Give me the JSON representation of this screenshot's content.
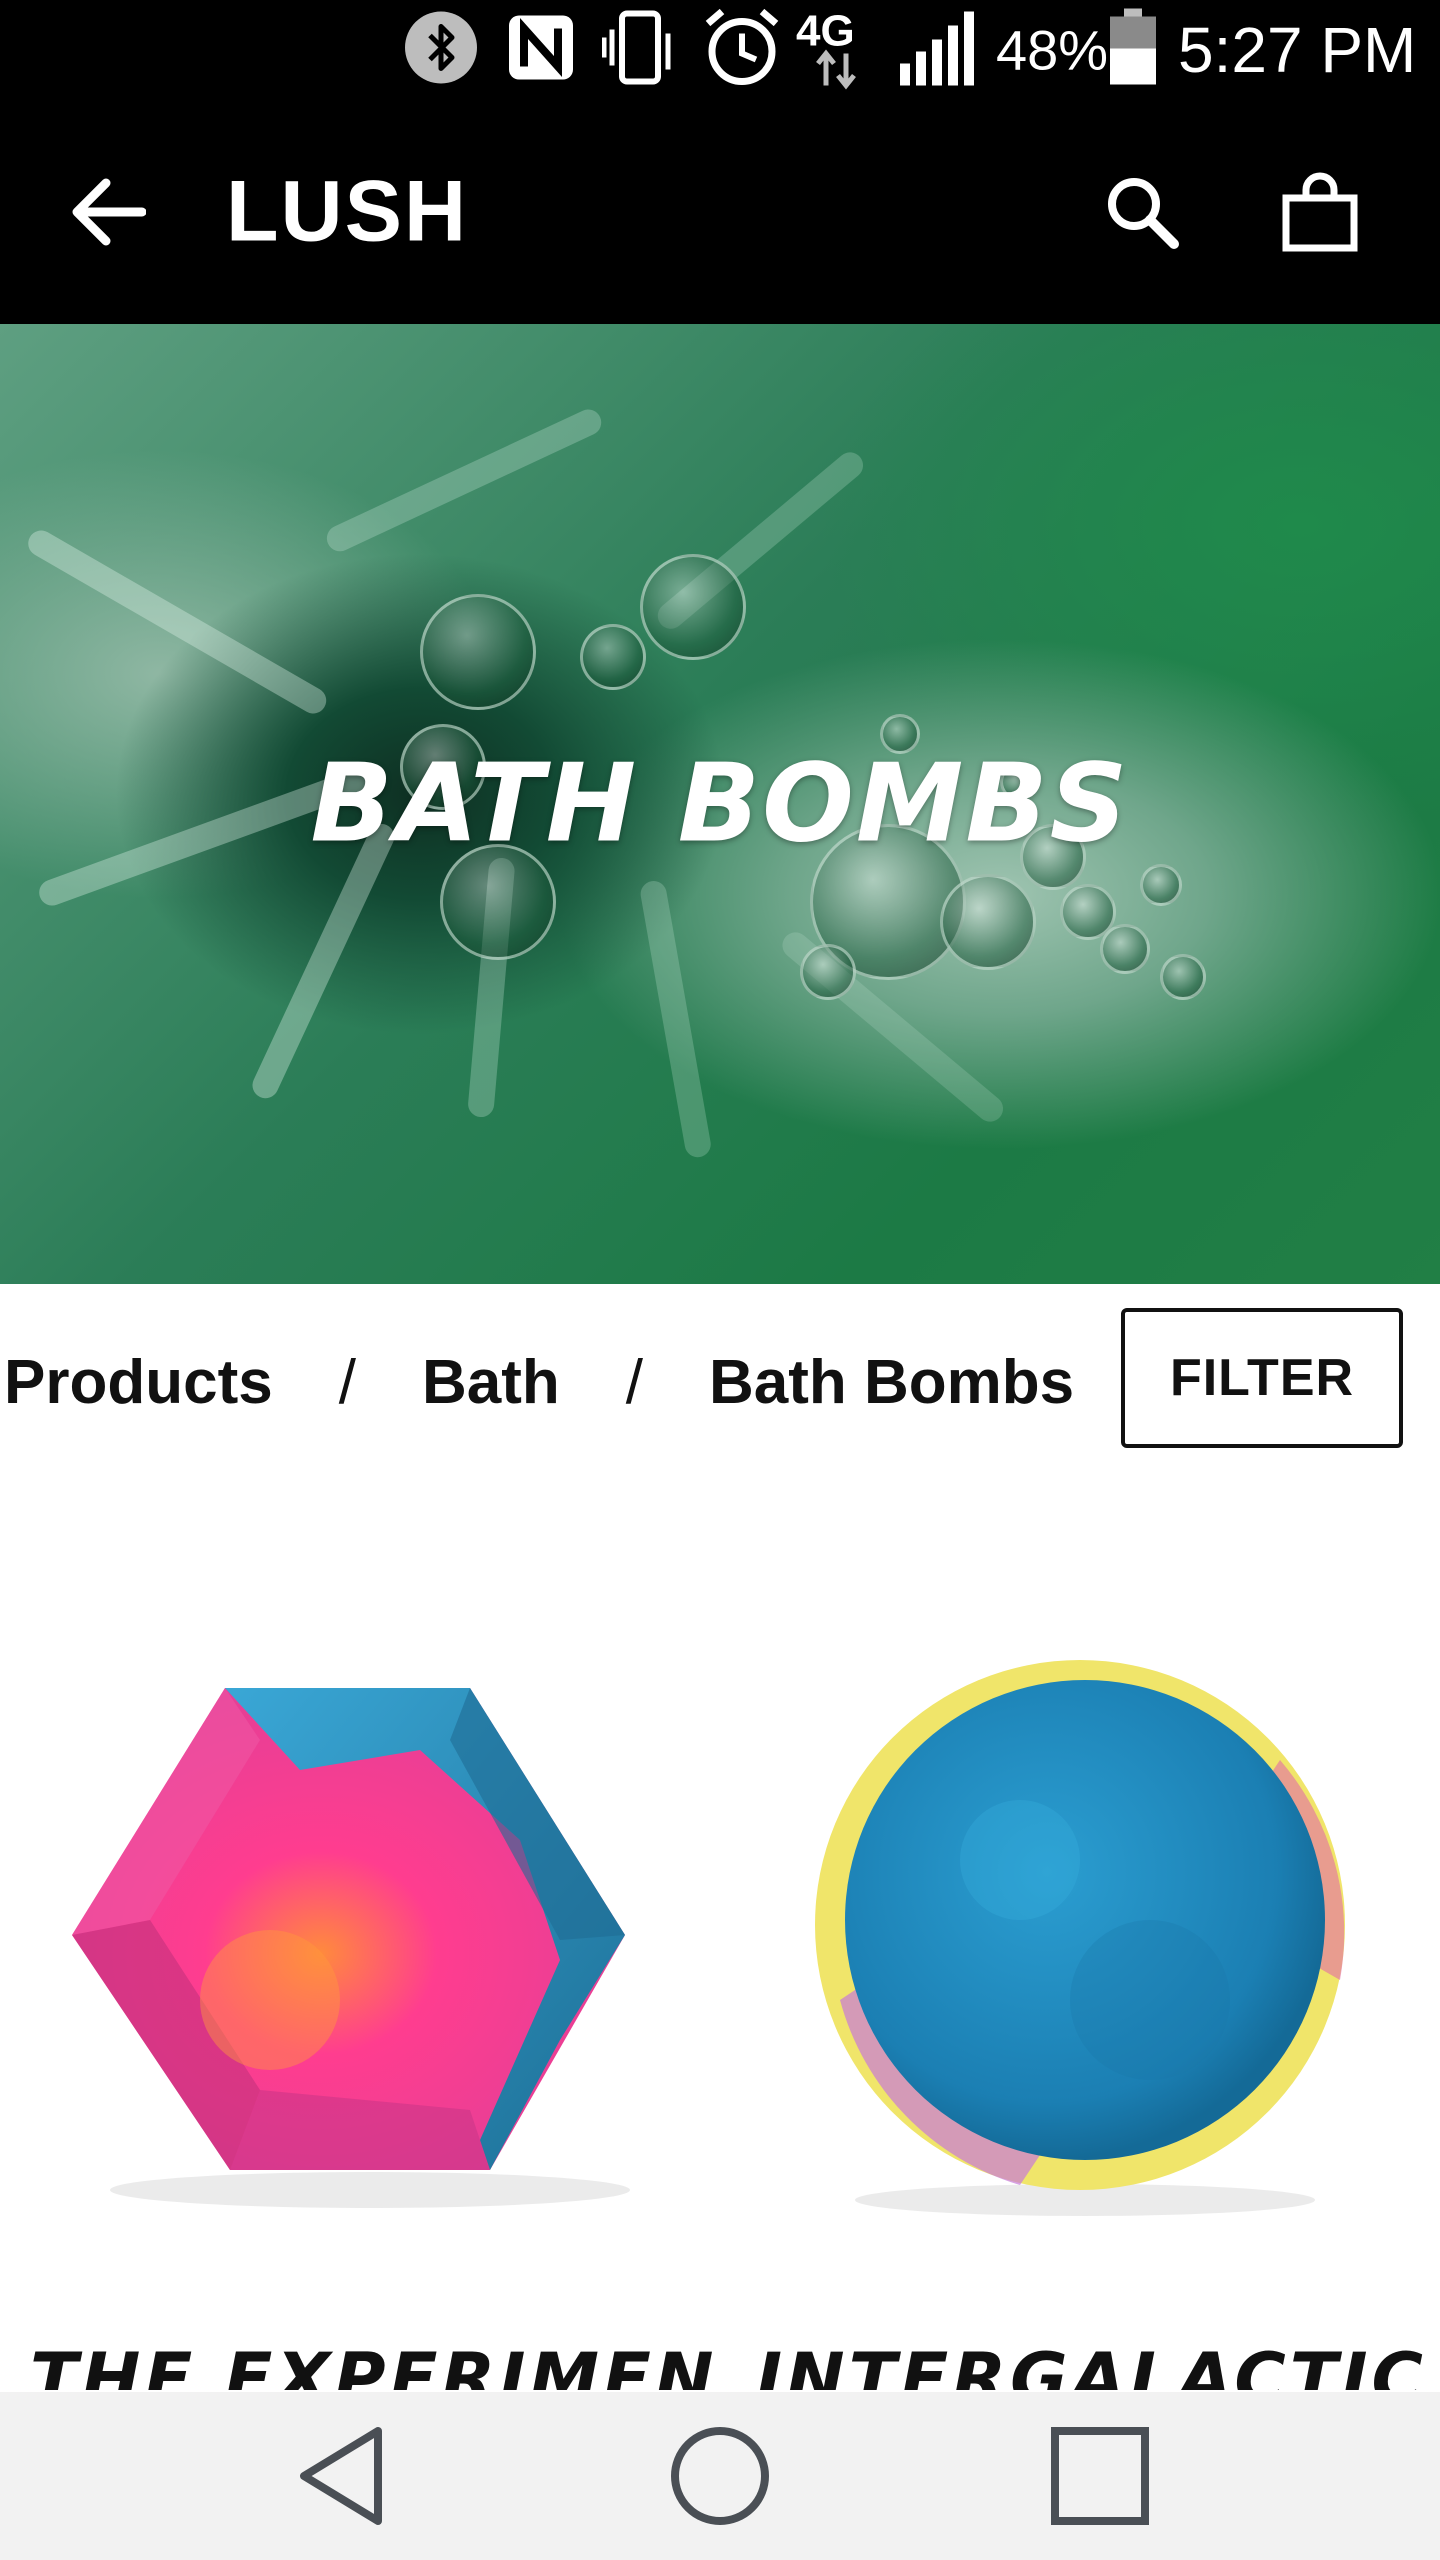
{
  "status_bar": {
    "battery": "48%",
    "time": "5:27 PM",
    "network": "4G",
    "icons": [
      "bluetooth-icon",
      "nfc-icon",
      "vibrate-icon",
      "alarm-icon",
      "4g-lte-icon",
      "signal-icon",
      "battery-icon"
    ]
  },
  "app_bar": {
    "title": "LUSH",
    "icons": [
      "back-arrow-icon",
      "search-icon",
      "shopping-bag-icon"
    ]
  },
  "hero": {
    "title": "BATH BOMBS"
  },
  "breadcrumb": {
    "items": [
      "Products",
      "Bath",
      "Bath Bombs"
    ],
    "separator": "/"
  },
  "filter": {
    "label": "FILTER"
  },
  "products": [
    {
      "name": "THE EXPERIMENTER"
    },
    {
      "name": "INTERGALACTIC"
    }
  ],
  "nav_bar": {
    "icons": [
      "back-triangle-icon",
      "home-circle-icon",
      "recents-square-icon"
    ]
  },
  "colors": {
    "bar_background": "#000000",
    "nav_background": "#f2f2f2",
    "hero_green": "#1c7a45",
    "text": "#111111"
  }
}
